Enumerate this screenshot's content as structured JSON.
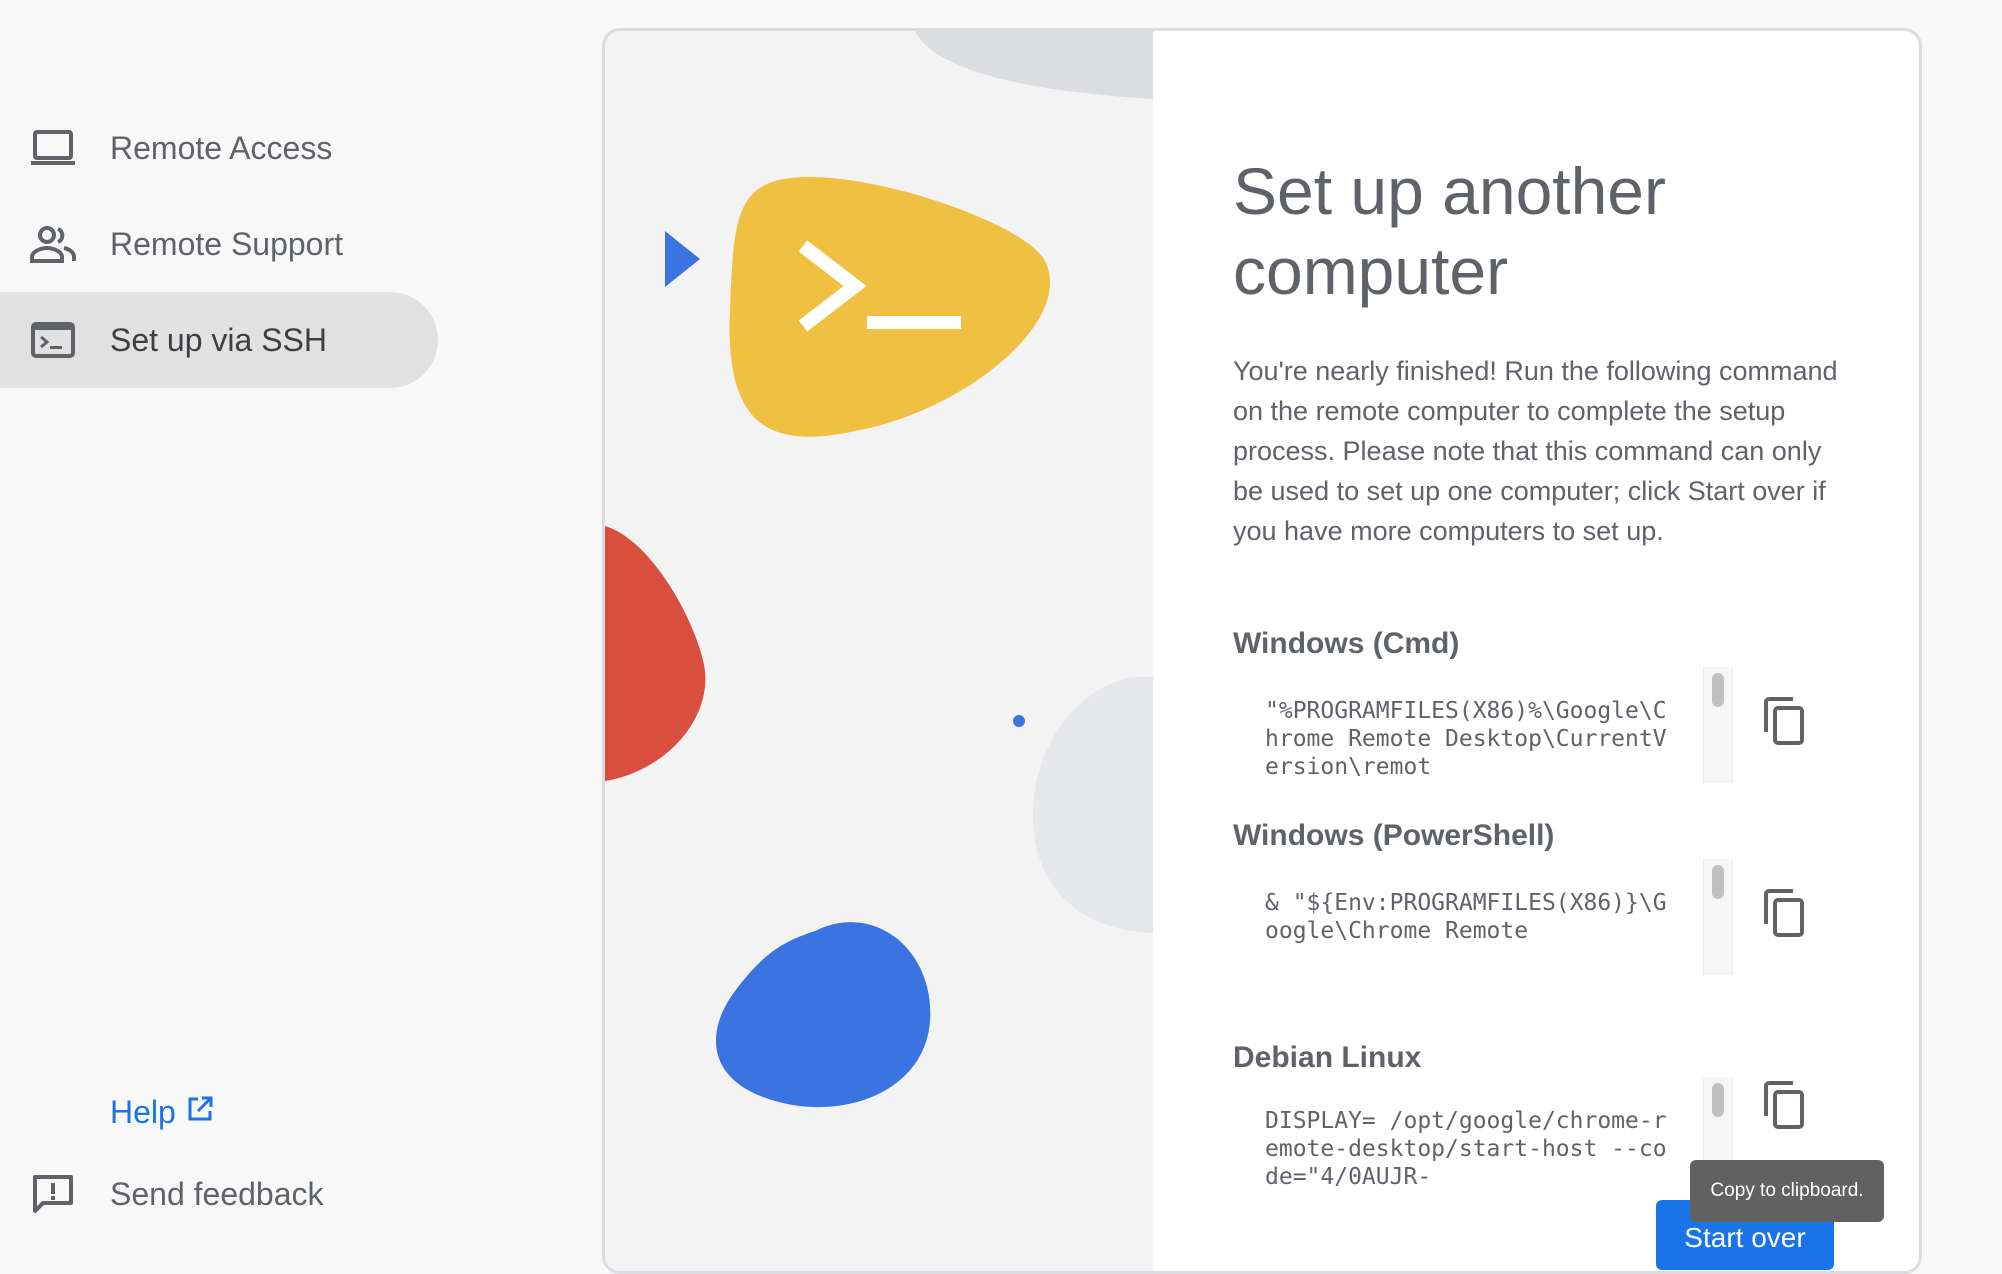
{
  "sidebar": {
    "items": [
      {
        "label": "Remote Access",
        "icon": "laptop-icon"
      },
      {
        "label": "Remote Support",
        "icon": "people-icon"
      },
      {
        "label": "Set up via SSH",
        "icon": "terminal-icon",
        "active": true
      }
    ],
    "help_label": "Help",
    "feedback_label": "Send feedback"
  },
  "main": {
    "title": "Set up another computer",
    "description": "You're nearly finished! Run the following command on the remote computer to complete the setup process. Please note that this command can only be used to set up one computer; click Start over if you have more computers to set up.",
    "commands": [
      {
        "heading": "Windows (Cmd)",
        "text": "\"%PROGRAMFILES(X86)%\\Google\\Chrome Remote Desktop\\CurrentVersion\\remot"
      },
      {
        "heading": "Windows (PowerShell)",
        "text": "& \"${Env:PROGRAMFILES(X86)}\\Google\\Chrome Remote"
      },
      {
        "heading": "Debian Linux",
        "text": "DISPLAY= /opt/google/chrome-remote-desktop/start-host --code=\"4/0AUJR-"
      }
    ],
    "tooltip": "Copy to clipboard.",
    "start_over_label": "Start over"
  },
  "colors": {
    "accent": "#1a73e8",
    "yellow": "#f0c043",
    "red": "#d94f3d",
    "blue": "#3b73e0",
    "active_nav": "#e1e1e1"
  }
}
